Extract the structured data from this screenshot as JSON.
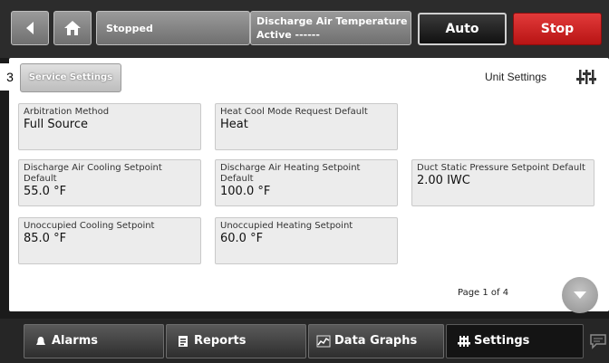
{
  "header": {
    "status": "Stopped",
    "detail_line1": "Discharge Air Temperature",
    "detail_line2": "Active ------",
    "auto_label": "Auto",
    "stop_label": "Stop"
  },
  "annotation_number": "3",
  "tabs": {
    "service_settings": "Service Settings",
    "unit_settings": "Unit Settings"
  },
  "fields": [
    {
      "label": "Arbitration Method",
      "value": "Full Source"
    },
    {
      "label": "Heat Cool Mode Request Default",
      "value": "Heat"
    },
    {
      "label": "Discharge Air Cooling Setpoint Default",
      "value": "55.0 °F"
    },
    {
      "label": "Discharge Air Heating Setpoint Default",
      "value": "100.0 °F"
    },
    {
      "label": "Duct Static Pressure Setpoint Default",
      "value": "2.00 IWC"
    },
    {
      "label": "Unoccupied Cooling Setpoint",
      "value": "85.0 °F"
    },
    {
      "label": "Unoccupied Heating Setpoint",
      "value": "60.0 °F"
    }
  ],
  "pagination": {
    "text": "Page 1 of 4"
  },
  "nav": {
    "alarms": "Alarms",
    "reports": "Reports",
    "data_graphs": "Data Graphs",
    "settings": "Settings"
  },
  "colors": {
    "stop": "#d42222",
    "panel": "#ffffff",
    "field_bg": "#ececec"
  }
}
